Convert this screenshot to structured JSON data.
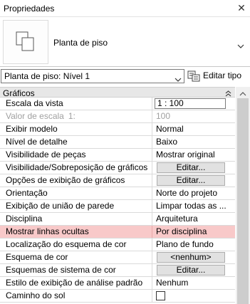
{
  "panel": {
    "title": "Propriedades",
    "close_glyph": "✕"
  },
  "type_selector": {
    "name": "Planta de piso",
    "icon": "floor-plan-type-icon"
  },
  "instance_filter": {
    "selected": "Planta de piso: Nível 1",
    "edit_type_label": "Editar tipo"
  },
  "grid": {
    "group": {
      "label": "Gráficos",
      "collapse_glyph": "⌃"
    },
    "rows": {
      "escala_da_vista": {
        "label": "Escala da vista",
        "value": "1 : 100"
      },
      "valor_de_escala": {
        "label": "Valor de escala",
        "label_extra": "1:",
        "value": "100"
      },
      "exibir_modelo": {
        "label": "Exibir modelo",
        "value": "Normal"
      },
      "nivel_de_detalhe": {
        "label": "Nível de detalhe",
        "value": "Baixo"
      },
      "visibilidade_de_pecas": {
        "label": "Visibilidade de peças",
        "value": "Mostrar original"
      },
      "visibilidade_sobreposicao": {
        "label": "Visibilidade/Sobreposição de gráficos",
        "value": "Editar..."
      },
      "opcoes_exibicao": {
        "label": "Opções de exibição de gráficos",
        "value": "Editar..."
      },
      "orientacao": {
        "label": "Orientação",
        "value": "Norte do projeto"
      },
      "uniao_de_parede": {
        "label": "Exibição de união de parede",
        "value": "Limpar todas as ..."
      },
      "disciplina": {
        "label": "Disciplina",
        "value": "Arquitetura"
      },
      "linhas_ocultas": {
        "label": "Mostrar linhas ocultas",
        "value": "Por disciplina"
      },
      "localizacao_esquema_cor": {
        "label": "Localização do esquema de cor",
        "value": "Plano de fundo"
      },
      "esquema_de_cor": {
        "label": "Esquema de cor",
        "value": "<nenhum>"
      },
      "esquemas_sistema_cor": {
        "label": "Esquemas de sistema de cor",
        "value": "Editar..."
      },
      "estilo_analise": {
        "label": "Estilo de exibição de análise padrão",
        "value": "Nenhum"
      },
      "caminho_do_sol": {
        "label": "Caminho do sol",
        "checked": false
      }
    }
  },
  "colors": {
    "highlight_row": "#f8c9c9",
    "group_header": "#e7e7e7"
  }
}
